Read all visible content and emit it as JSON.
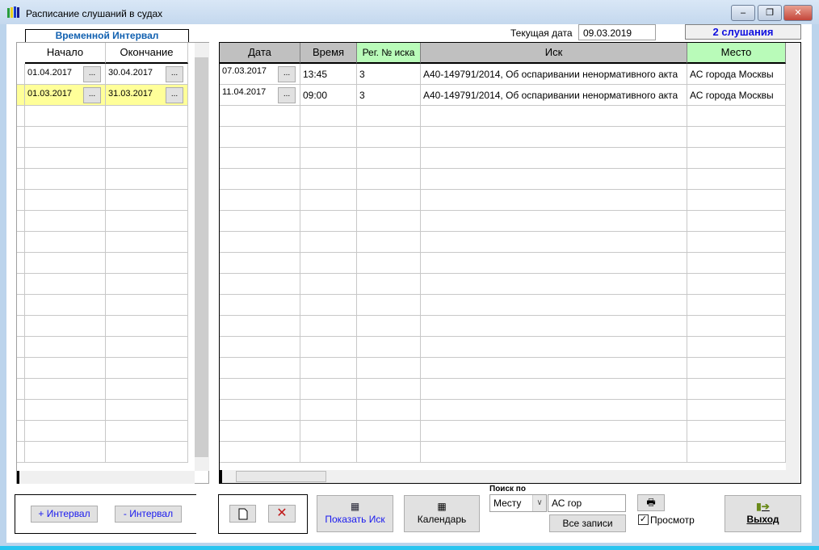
{
  "window": {
    "title": "Расписание слушаний в судах",
    "minimize": "–",
    "restore": "❐",
    "close": "✕"
  },
  "header": {
    "current_date_label": "Текущая дата",
    "current_date": "09.03.2019",
    "count": "2 слушания"
  },
  "intervals": {
    "tab_label": "Временной Интервал",
    "columns": [
      "Начало",
      "Окончание"
    ],
    "rows": [
      {
        "start": "01.04.2017",
        "end": "30.04.2017",
        "selected": false
      },
      {
        "start": "01.03.2017",
        "end": "31.03.2017",
        "selected": true
      }
    ],
    "dots": "...",
    "add": "+ Интервал",
    "remove": "- Интервал"
  },
  "hearings": {
    "columns": [
      "Дата",
      "Время",
      "Рег. № иска",
      "Иск",
      "Место"
    ],
    "rows": [
      {
        "date": "07.03.2017",
        "time": "13:45",
        "reg": "3",
        "claim": "А40-149791/2014, Об оспаривании ненормативного акта",
        "place": "АС города Москвы"
      },
      {
        "date": "11.04.2017",
        "time": "09:00",
        "reg": "3",
        "claim": "А40-149791/2014, Об оспаривании ненормативного акта",
        "place": "АС города Москвы"
      }
    ]
  },
  "toolbar": {
    "show_claim": "Показать Иск",
    "calendar": "Календарь",
    "search_label": "Поиск по",
    "search_field": "Месту",
    "search_value": "АС гор",
    "all_records": "Все записи",
    "preview": "Просмотр",
    "preview_checked": true,
    "exit": "Выход"
  },
  "colors": {
    "selected_row": "#ffff99",
    "green_header": "#b9fbb9",
    "gray_header": "#c0c0c0",
    "count_text": "#1010e0"
  }
}
